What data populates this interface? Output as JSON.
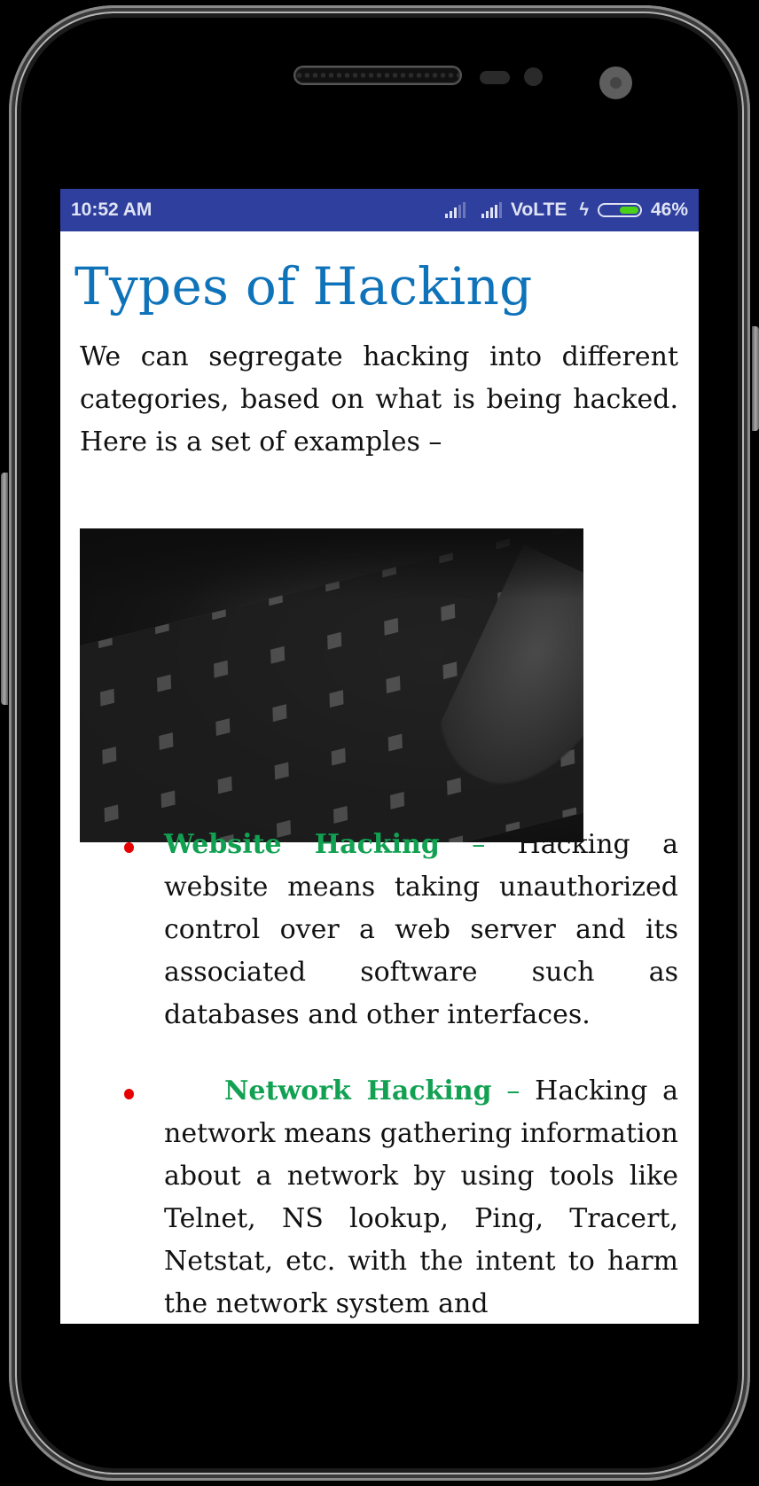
{
  "status_bar": {
    "time": "10:52 AM",
    "network_label": "VoLTE",
    "battery_percent": "46%",
    "battery_level": 0.46,
    "icons": [
      "signal-icon",
      "signal-icon",
      "charging-bolt-icon",
      "battery-icon"
    ]
  },
  "page": {
    "title": "Types of Hacking",
    "intro": "We can segregate hacking into different categories, based on what is being hacked. Here is a set of examples –",
    "image_alt": "laptop-keyboard-photo",
    "items": [
      {
        "term": "Website Hacking",
        "dash": "–",
        "description": "Hacking a website means taking unauthorized control over a web server and its associated software such as databases and other interfaces."
      },
      {
        "term": "Network Hacking",
        "dash": "–",
        "description": "Hacking a network means gathering information about a network by using tools like Telnet, NS lookup, Ping, Tracert, Netstat, etc. with the intent to harm the network system and"
      }
    ]
  },
  "colors": {
    "status_bar": "#2f3f9e",
    "title": "#0f73b9",
    "term": "#12a152",
    "bullet": "#e60000",
    "battery_fill": "#4cd319"
  }
}
